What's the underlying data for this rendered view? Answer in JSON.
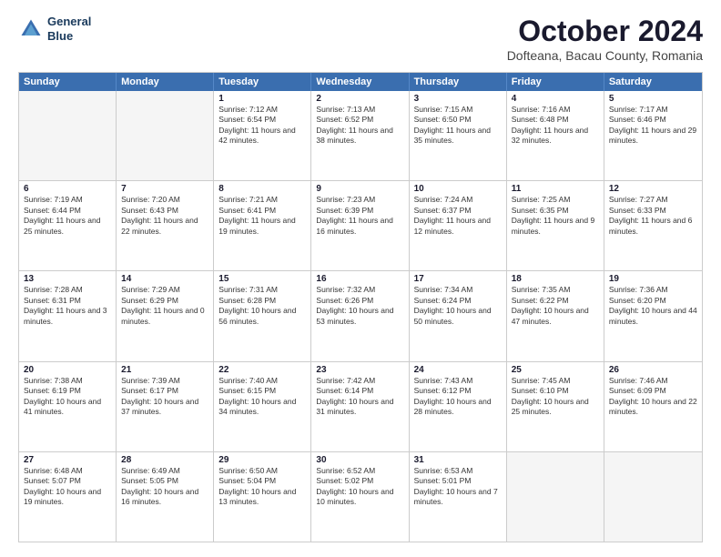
{
  "header": {
    "logo_line1": "General",
    "logo_line2": "Blue",
    "month": "October 2024",
    "location": "Dofteana, Bacau County, Romania"
  },
  "weekdays": [
    "Sunday",
    "Monday",
    "Tuesday",
    "Wednesday",
    "Thursday",
    "Friday",
    "Saturday"
  ],
  "rows": [
    [
      {
        "day": "",
        "text": "",
        "empty": true
      },
      {
        "day": "",
        "text": "",
        "empty": true
      },
      {
        "day": "1",
        "text": "Sunrise: 7:12 AM\nSunset: 6:54 PM\nDaylight: 11 hours and 42 minutes."
      },
      {
        "day": "2",
        "text": "Sunrise: 7:13 AM\nSunset: 6:52 PM\nDaylight: 11 hours and 38 minutes."
      },
      {
        "day": "3",
        "text": "Sunrise: 7:15 AM\nSunset: 6:50 PM\nDaylight: 11 hours and 35 minutes."
      },
      {
        "day": "4",
        "text": "Sunrise: 7:16 AM\nSunset: 6:48 PM\nDaylight: 11 hours and 32 minutes."
      },
      {
        "day": "5",
        "text": "Sunrise: 7:17 AM\nSunset: 6:46 PM\nDaylight: 11 hours and 29 minutes."
      }
    ],
    [
      {
        "day": "6",
        "text": "Sunrise: 7:19 AM\nSunset: 6:44 PM\nDaylight: 11 hours and 25 minutes."
      },
      {
        "day": "7",
        "text": "Sunrise: 7:20 AM\nSunset: 6:43 PM\nDaylight: 11 hours and 22 minutes."
      },
      {
        "day": "8",
        "text": "Sunrise: 7:21 AM\nSunset: 6:41 PM\nDaylight: 11 hours and 19 minutes."
      },
      {
        "day": "9",
        "text": "Sunrise: 7:23 AM\nSunset: 6:39 PM\nDaylight: 11 hours and 16 minutes."
      },
      {
        "day": "10",
        "text": "Sunrise: 7:24 AM\nSunset: 6:37 PM\nDaylight: 11 hours and 12 minutes."
      },
      {
        "day": "11",
        "text": "Sunrise: 7:25 AM\nSunset: 6:35 PM\nDaylight: 11 hours and 9 minutes."
      },
      {
        "day": "12",
        "text": "Sunrise: 7:27 AM\nSunset: 6:33 PM\nDaylight: 11 hours and 6 minutes."
      }
    ],
    [
      {
        "day": "13",
        "text": "Sunrise: 7:28 AM\nSunset: 6:31 PM\nDaylight: 11 hours and 3 minutes."
      },
      {
        "day": "14",
        "text": "Sunrise: 7:29 AM\nSunset: 6:29 PM\nDaylight: 11 hours and 0 minutes."
      },
      {
        "day": "15",
        "text": "Sunrise: 7:31 AM\nSunset: 6:28 PM\nDaylight: 10 hours and 56 minutes."
      },
      {
        "day": "16",
        "text": "Sunrise: 7:32 AM\nSunset: 6:26 PM\nDaylight: 10 hours and 53 minutes."
      },
      {
        "day": "17",
        "text": "Sunrise: 7:34 AM\nSunset: 6:24 PM\nDaylight: 10 hours and 50 minutes."
      },
      {
        "day": "18",
        "text": "Sunrise: 7:35 AM\nSunset: 6:22 PM\nDaylight: 10 hours and 47 minutes."
      },
      {
        "day": "19",
        "text": "Sunrise: 7:36 AM\nSunset: 6:20 PM\nDaylight: 10 hours and 44 minutes."
      }
    ],
    [
      {
        "day": "20",
        "text": "Sunrise: 7:38 AM\nSunset: 6:19 PM\nDaylight: 10 hours and 41 minutes."
      },
      {
        "day": "21",
        "text": "Sunrise: 7:39 AM\nSunset: 6:17 PM\nDaylight: 10 hours and 37 minutes."
      },
      {
        "day": "22",
        "text": "Sunrise: 7:40 AM\nSunset: 6:15 PM\nDaylight: 10 hours and 34 minutes."
      },
      {
        "day": "23",
        "text": "Sunrise: 7:42 AM\nSunset: 6:14 PM\nDaylight: 10 hours and 31 minutes."
      },
      {
        "day": "24",
        "text": "Sunrise: 7:43 AM\nSunset: 6:12 PM\nDaylight: 10 hours and 28 minutes."
      },
      {
        "day": "25",
        "text": "Sunrise: 7:45 AM\nSunset: 6:10 PM\nDaylight: 10 hours and 25 minutes."
      },
      {
        "day": "26",
        "text": "Sunrise: 7:46 AM\nSunset: 6:09 PM\nDaylight: 10 hours and 22 minutes."
      }
    ],
    [
      {
        "day": "27",
        "text": "Sunrise: 6:48 AM\nSunset: 5:07 PM\nDaylight: 10 hours and 19 minutes."
      },
      {
        "day": "28",
        "text": "Sunrise: 6:49 AM\nSunset: 5:05 PM\nDaylight: 10 hours and 16 minutes."
      },
      {
        "day": "29",
        "text": "Sunrise: 6:50 AM\nSunset: 5:04 PM\nDaylight: 10 hours and 13 minutes."
      },
      {
        "day": "30",
        "text": "Sunrise: 6:52 AM\nSunset: 5:02 PM\nDaylight: 10 hours and 10 minutes."
      },
      {
        "day": "31",
        "text": "Sunrise: 6:53 AM\nSunset: 5:01 PM\nDaylight: 10 hours and 7 minutes."
      },
      {
        "day": "",
        "text": "",
        "empty": true
      },
      {
        "day": "",
        "text": "",
        "empty": true
      }
    ]
  ]
}
